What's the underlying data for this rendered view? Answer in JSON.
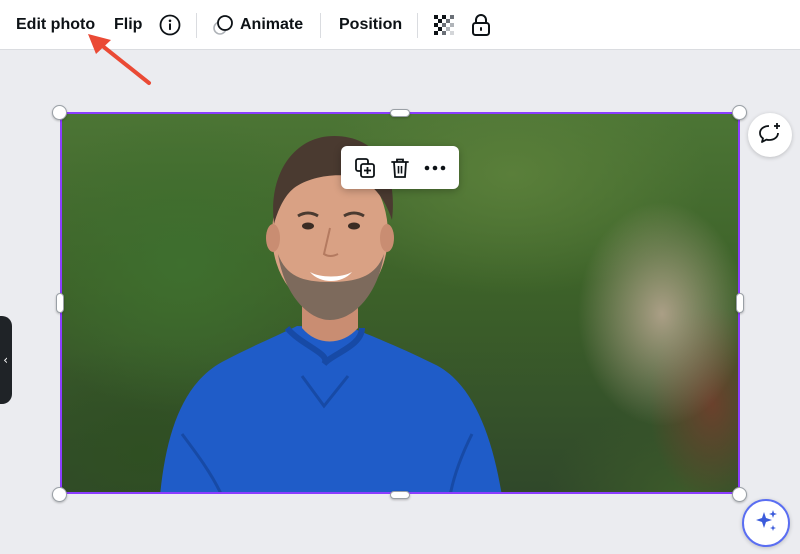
{
  "toolbar": {
    "edit_photo_label": "Edit photo",
    "flip_label": "Flip",
    "info_icon": "info-icon",
    "animate_icon": "animate-icon",
    "animate_label": "Animate",
    "position_label": "Position",
    "transparency_icon": "transparency-icon",
    "lock_icon": "lock-icon"
  },
  "annotation": {
    "arrow_color": "#ea4a35"
  },
  "canvas": {
    "selection_color": "#8b3dff",
    "background_color": "#ebecf0"
  },
  "context_menu": {
    "items": [
      {
        "icon": "duplicate-icon"
      },
      {
        "icon": "trash-icon"
      },
      {
        "icon": "more-icon"
      }
    ]
  },
  "side_buttons": {
    "comment_icon": "add-comment-icon",
    "magic_icon": "sparkle-icon",
    "magic_border_color": "#5a6ef2"
  },
  "side_tab": {
    "glyph": "‹"
  }
}
